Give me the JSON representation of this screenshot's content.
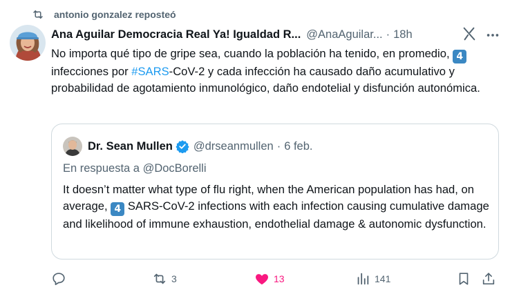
{
  "repost": {
    "text": "antonio gonzalez reposteó",
    "icon": "repost-icon"
  },
  "tweet": {
    "author_name": "Ana Aguilar Democracia Real Ya! Igualdad R...",
    "handle": "@AnaAguilar...",
    "separator": "·",
    "time": "18h",
    "text_part1": "No importa qué tipo de gripe sea, cuando la población ha tenido, en promedio,",
    "emoji": "4",
    "text_part2": "infecciones por",
    "hashtag": "#SARS",
    "text_part3": "-CoV-2 y cada infección ha causado daño acumulativo y probabilidad de agotamiento inmunológico, daño endotelial y disfunción autonómica."
  },
  "quote": {
    "author_name": "Dr. Sean Mullen",
    "handle": "@drseanmullen",
    "separator": "·",
    "time": "6 feb.",
    "reply_to": "En respuesta a @DocBorelli",
    "text_part1": "It doesn’t matter what type of flu right, when the American population has had, on average,",
    "emoji": "4",
    "text_part2": "SARS-CoV-2 infections with each infection  causing cumulative damage and likelihood of immune exhaustion, endothelial damage & autonomic dysfunction."
  },
  "actions": {
    "reply_count": "",
    "repost_count": "3",
    "like_count": "13",
    "views_count": "141"
  },
  "colors": {
    "accent": "#1d9bf0",
    "like": "#f91880",
    "muted": "#536471",
    "verified": "#1d9bf0"
  }
}
